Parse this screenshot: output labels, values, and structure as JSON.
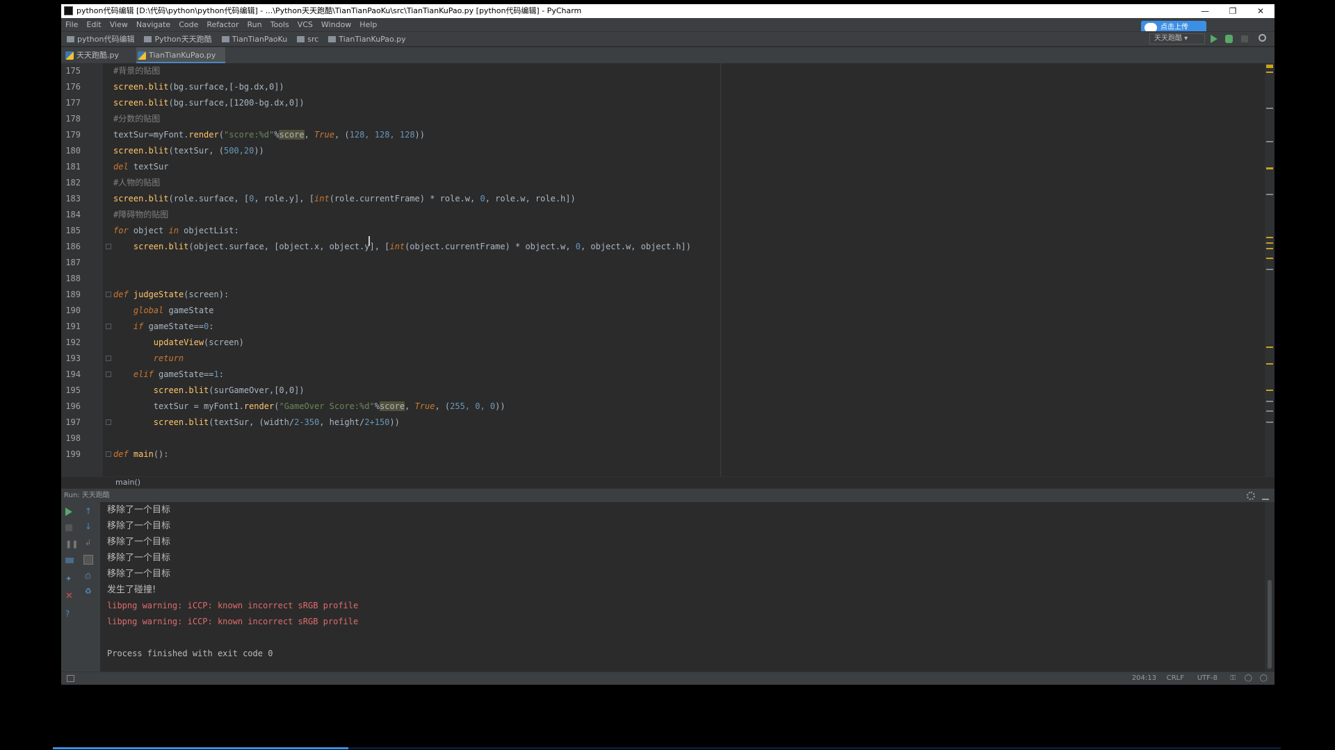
{
  "window": {
    "title": "python代码编辑 [D:\\代码\\python\\python代码编辑] - ...\\Python天天跑酷\\TianTianPaoKu\\src\\TianTianKuPao.py [python代码编辑] - PyCharm",
    "minimize_icon": "minimize-icon",
    "maximize_icon": "restore-icon",
    "close_icon": "close-icon"
  },
  "menu": [
    "File",
    "Edit",
    "View",
    "Navigate",
    "Code",
    "Refactor",
    "Run",
    "Tools",
    "VCS",
    "Window",
    "Help"
  ],
  "upload_button": "点击上传",
  "breadcrumbs": [
    "python代码编辑",
    "Python天天跑酷",
    "TianTianPaoKu",
    "src",
    "TianTianKuPao.py"
  ],
  "run_config": "天天跑酷",
  "tabs": [
    {
      "label": "天天跑酷.py",
      "active": false
    },
    {
      "label": "TianTianKuPao.py",
      "active": true
    }
  ],
  "code_lines": [
    {
      "n": "175",
      "tokens": [
        {
          "c": "cm",
          "t": "#背景的贴图"
        }
      ]
    },
    {
      "n": "176",
      "tokens": [
        {
          "c": "fn",
          "t": "screen.blit"
        },
        {
          "c": "",
          "t": "(bg.surface,[-bg.dx,0])"
        }
      ]
    },
    {
      "n": "177",
      "tokens": [
        {
          "c": "fn",
          "t": "screen.blit"
        },
        {
          "c": "",
          "t": "(bg.surface,[1200-bg.dx,0])"
        }
      ]
    },
    {
      "n": "178",
      "tokens": [
        {
          "c": "cm",
          "t": "#分数的贴图"
        }
      ]
    },
    {
      "n": "179",
      "tokens": [
        {
          "c": "",
          "t": "textSur=myFont."
        },
        {
          "c": "fn",
          "t": "render"
        },
        {
          "c": "",
          "t": "("
        },
        {
          "c": "str",
          "t": "\"score:%d\""
        },
        {
          "c": "",
          "t": "%"
        },
        {
          "c": "hl",
          "t": "score"
        },
        {
          "c": "",
          "t": ", "
        },
        {
          "c": "kw",
          "t": "True"
        },
        {
          "c": "",
          "t": ", ("
        },
        {
          "c": "num",
          "t": "128, 128, 128"
        },
        {
          "c": "",
          "t": "))"
        }
      ]
    },
    {
      "n": "180",
      "tokens": [
        {
          "c": "fn",
          "t": "screen.blit"
        },
        {
          "c": "",
          "t": "(textSur, ("
        },
        {
          "c": "num",
          "t": "500,20"
        },
        {
          "c": "",
          "t": "))"
        }
      ]
    },
    {
      "n": "181",
      "tokens": [
        {
          "c": "kw",
          "t": "del"
        },
        {
          "c": "",
          "t": " textSur"
        }
      ]
    },
    {
      "n": "182",
      "tokens": [
        {
          "c": "cm",
          "t": "#人物的贴图"
        }
      ]
    },
    {
      "n": "183",
      "tokens": [
        {
          "c": "fn",
          "t": "screen.blit"
        },
        {
          "c": "",
          "t": "(role.surface, ["
        },
        {
          "c": "num",
          "t": "0"
        },
        {
          "c": "",
          "t": ", role.y], ["
        },
        {
          "c": "kw",
          "t": "int"
        },
        {
          "c": "",
          "t": "(role.currentFrame) * role.w, "
        },
        {
          "c": "num",
          "t": "0"
        },
        {
          "c": "",
          "t": ", role.w, role.h])"
        }
      ]
    },
    {
      "n": "184",
      "tokens": [
        {
          "c": "cm",
          "t": "#障碍物的贴图"
        }
      ]
    },
    {
      "n": "185",
      "tokens": [
        {
          "c": "kw",
          "t": "for"
        },
        {
          "c": "",
          "t": " object "
        },
        {
          "c": "kw",
          "t": "in"
        },
        {
          "c": "",
          "t": " objectList:"
        }
      ]
    },
    {
      "n": "186",
      "tokens": [
        {
          "c": "",
          "t": "    "
        },
        {
          "c": "fn",
          "t": "screen.blit"
        },
        {
          "c": "",
          "t": "(object.surface, [object.x, object.y], ["
        },
        {
          "c": "kw",
          "t": "int"
        },
        {
          "c": "",
          "t": "(object.currentFrame) * object.w, "
        },
        {
          "c": "num",
          "t": "0"
        },
        {
          "c": "",
          "t": ", object.w, object.h])"
        }
      ]
    },
    {
      "n": "187",
      "tokens": []
    },
    {
      "n": "188",
      "tokens": []
    },
    {
      "n": "189",
      "tokens": [
        {
          "c": "kw",
          "t": "def"
        },
        {
          "c": "",
          "t": " "
        },
        {
          "c": "fn",
          "t": "judgeState"
        },
        {
          "c": "",
          "t": "(screen):"
        }
      ]
    },
    {
      "n": "190",
      "tokens": [
        {
          "c": "",
          "t": "    "
        },
        {
          "c": "kw",
          "t": "global"
        },
        {
          "c": "",
          "t": " gameState"
        }
      ]
    },
    {
      "n": "191",
      "tokens": [
        {
          "c": "",
          "t": "    "
        },
        {
          "c": "kw",
          "t": "if"
        },
        {
          "c": "",
          "t": " gameState=="
        },
        {
          "c": "num",
          "t": "0"
        },
        {
          "c": "",
          "t": ":"
        }
      ]
    },
    {
      "n": "192",
      "tokens": [
        {
          "c": "",
          "t": "        "
        },
        {
          "c": "fn",
          "t": "updateView"
        },
        {
          "c": "",
          "t": "(screen)"
        }
      ]
    },
    {
      "n": "193",
      "tokens": [
        {
          "c": "",
          "t": "        "
        },
        {
          "c": "kw",
          "t": "return"
        }
      ]
    },
    {
      "n": "194",
      "tokens": [
        {
          "c": "",
          "t": "    "
        },
        {
          "c": "kw",
          "t": "elif"
        },
        {
          "c": "",
          "t": " gameState=="
        },
        {
          "c": "num",
          "t": "1"
        },
        {
          "c": "",
          "t": ":"
        }
      ]
    },
    {
      "n": "195",
      "tokens": [
        {
          "c": "",
          "t": "        "
        },
        {
          "c": "fn",
          "t": "screen.blit"
        },
        {
          "c": "",
          "t": "(surGameOver,[0,0])"
        }
      ]
    },
    {
      "n": "196",
      "tokens": [
        {
          "c": "",
          "t": "        textSur = myFont1."
        },
        {
          "c": "fn",
          "t": "render"
        },
        {
          "c": "",
          "t": "("
        },
        {
          "c": "str",
          "t": "\"GameOver Score:%d\""
        },
        {
          "c": "",
          "t": "%"
        },
        {
          "c": "hl",
          "t": "score"
        },
        {
          "c": "",
          "t": ", "
        },
        {
          "c": "kw",
          "t": "True"
        },
        {
          "c": "",
          "t": ", ("
        },
        {
          "c": "num",
          "t": "255, 0, 0"
        },
        {
          "c": "",
          "t": "))"
        }
      ]
    },
    {
      "n": "197",
      "tokens": [
        {
          "c": "",
          "t": "        "
        },
        {
          "c": "fn",
          "t": "screen.blit"
        },
        {
          "c": "",
          "t": "(textSur, (width/"
        },
        {
          "c": "num",
          "t": "2-350"
        },
        {
          "c": "",
          "t": ", height/"
        },
        {
          "c": "num",
          "t": "2+150"
        },
        {
          "c": "",
          "t": "))"
        }
      ]
    },
    {
      "n": "198",
      "tokens": []
    },
    {
      "n": "199",
      "tokens": [
        {
          "c": "kw",
          "t": "def"
        },
        {
          "c": "",
          "t": " "
        },
        {
          "c": "fn",
          "t": "main"
        },
        {
          "c": "",
          "t": "():"
        }
      ]
    }
  ],
  "editor_breadcrumb": "main()",
  "run_panel": {
    "header": "Run: 天天跑酷",
    "lines": [
      {
        "kind": "norm",
        "text": "移除了一个目标"
      },
      {
        "kind": "norm",
        "text": "移除了一个目标"
      },
      {
        "kind": "norm",
        "text": "移除了一个目标"
      },
      {
        "kind": "norm",
        "text": "移除了一个目标"
      },
      {
        "kind": "norm",
        "text": "移除了一个目标"
      },
      {
        "kind": "norm",
        "text": "发生了碰撞!"
      },
      {
        "kind": "err",
        "text": "libpng warning: iCCP: known incorrect sRGB profile"
      },
      {
        "kind": "err",
        "text": "libpng warning: iCCP: known incorrect sRGB profile"
      },
      {
        "kind": "blank",
        "text": ""
      },
      {
        "kind": "exit",
        "text": "Process finished with exit code 0"
      }
    ]
  },
  "status": {
    "position": "204:13",
    "line_sep": "CRLF",
    "encoding": "UTF-8"
  },
  "colors": {
    "accent": "#3d8fe6",
    "run_green": "#59a869",
    "error_red": "#e06c6c"
  }
}
